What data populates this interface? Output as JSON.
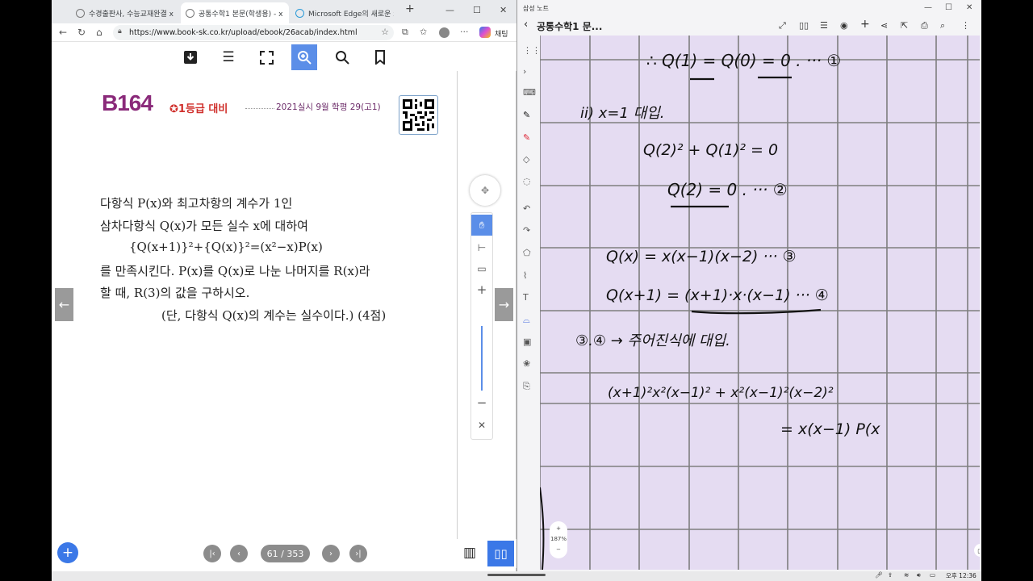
{
  "browser": {
    "tabs": [
      {
        "label": "수경출판사, 수능교재완결 x"
      },
      {
        "label": "공통수학1 본문(학생용) - x"
      },
      {
        "label": "Microsoft Edge의 새로운 x"
      }
    ],
    "new_tab": "+",
    "url": "https://www.book-sk.co.kr/upload/ebook/26acab/index.html",
    "chat_label": "채팅",
    "window": {
      "minimize": "—",
      "maximize": "☐",
      "close": "✕"
    }
  },
  "ebook": {
    "problem_number": "B164",
    "grade_tag": "✪1등급 대비",
    "source": "2021실시 9월 학평 29(고1)",
    "lines": [
      "다항식 P(x)와 최고차항의 계수가 1인",
      "삼차다항식 Q(x)가 모든 실수 x에 대하여",
      "{Q(x+1)}²+{Q(x)}²=(x²−x)P(x)",
      "를 만족시킨다. P(x)를 Q(x)로 나눈 나머지를 R(x)라",
      "할 때, R(3)의 값을 구하시오.",
      "(단, 다항식 Q(x)의 계수는 실수이다.) (4점)"
    ],
    "page_indicator": "61 / 353",
    "prev_arrow": "←",
    "next_arrow": "→"
  },
  "notes": {
    "app_name": "삼성 노트",
    "title": "공통수학1 문...",
    "zoom_level": "187%",
    "handwriting": [
      "∴  Q(1) = Q(0) = 0 . ··· ①",
      "ii) x=1 대입.",
      "Q(2)² + Q(1)² = 0",
      "Q(2) = 0 . ··· ②",
      "Q(x) = x(x−1)(x−2) ··· ③",
      "Q(x+1) = (x+1)·x·(x−1) ··· ④",
      "③.④ → 주어진식에 대입.",
      "(x+1)²x²(x−1)² + x²(x−1)²(x−2)²",
      "= x(x−1) P(x"
    ],
    "grid_color": "#7e7e7e",
    "paper_color": "#e5dcf2",
    "ink_color": "#111111"
  },
  "taskbar": {
    "time": "오후 12:36"
  }
}
